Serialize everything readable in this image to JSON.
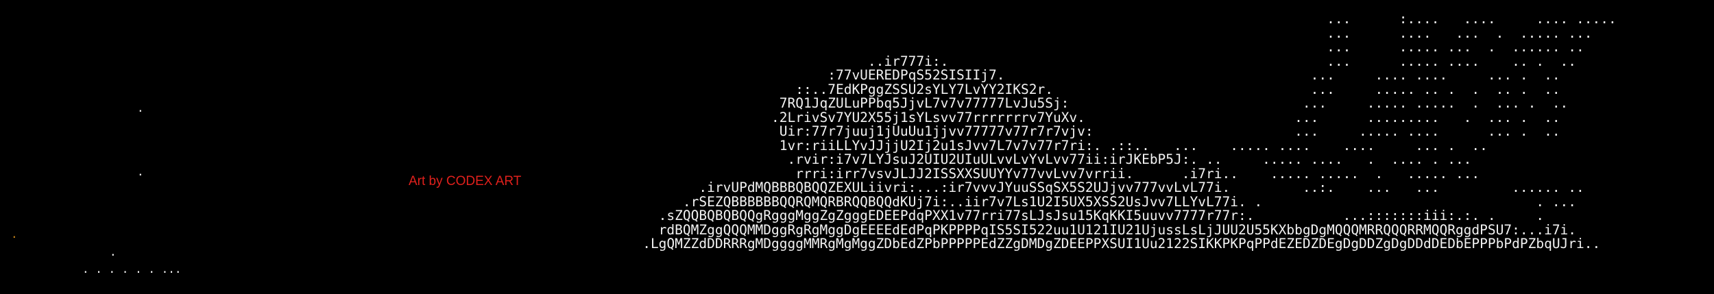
{
  "credit_text": "Art by CODEX ART",
  "accent_color": "#e0201c",
  "text_color": "#f2f2f2",
  "background_color": "#000000",
  "art_lines": [
    "                                                                                                                                                                     ...      :....   ....     .... .....",
    "                                                                                                                                                                     ...      ....   ...  .  ..... ...",
    "                                                                                                                                                                     ...      ..... ...  .  ...... ..",
    "                                                                                                            ..ir777i:.                                               ...      ..... ....    .. .  ..",
    "                                                                                                       :77vUEREDPqS52SISIIj7.                                      ...     .... ....     ... .  ..",
    "                                                                                                   ::..7EdKPggZSSU2sYLY7LvYY2IKS2r.                                ...     ..... .. .  .  .. .  ..",
    "                                                                                                 7RQ1JqZULuPPbq5JjvL7v7v77777LvJu5Sj:                             ...     ..... .....  .  ... .  ..",
    "                                                                                                .2LrivSv7YU2X55j1sYLsvv77rrrrrrrv7YuXv.                          ...      .........   .  ... .  ..",
    "                                                                                                 Uir:77r7juuj1jUuUu1jjvv77777v77r7r7vjv:                         ...     ..... ....      ... .  ..",
    "                                                                                                 1vr:riiLLYvJJjjU2Ij2u1sJvv7L7v7v77r7ri:. .::..   ...    ..... ....    ....     ... .  ..",
    "                                                                                                  .rvir:i7v7LYJsuJ2UIU2UIuULvvLvYvLvv77ii:irJKEbP5J:. ..     ..... ....   .  .... . ...",
    "                                                                                                   rrri:irr7vsvJLJJ2ISSXXSUUYYv77vvLvv7vrrii.      .i7ri..    ..... .....  .   ..... ...",
    "                                                                                       .irvUPdMQBBBQBQQZEXULiivri:...:ir7vvvJYuuSSqSX5S2UJjvv777vvLvL77i.         ..:.    ...   ...         ...... ..",
    "                                                                                     .rSEZQBBBBBBQQRQMQRBRQQBQQdKUj7i:..iir7v7Ls1U2I5UX5XSS2UsJvv7LLYvL77i. .                                  . ...",
    "                                                                                  .sZQQBQBQBQQgRgggMggZgZgggEDEEPdqPXX1v77rri77sLJsJsu15KqKKI5uuvv7777r77r:.           ...:::::::iii:.:. .     .",
    "                                                                                  rdBQMZggQQQMMDggRgRgMggDgEEEEdEdPqPKPPPPqIS5SI522uu1U121IU21UjussLsLjJUU2U55KXbbgDgMQQQMRRQQQRRMQQRggdPSU7:...i7i.",
    "                                                                                .LgQMZZdDDRRRgMDggggMMRgMgMggZDbEdZPbPPPPPEdZZgDMDgZDEEPPXSUI1Uu2122SIKKPKPqPPdEZEDZDEgDgDDZgDgDDdDEDbEPPPbPdPZbqUJri.."
  ],
  "stars": [
    {
      "glyph": "."
    },
    {
      "glyph": "."
    },
    {
      "glyph": "."
    },
    {
      "glyph": ". . .    . . . ..."
    },
    {
      "glyph": "."
    }
  ]
}
